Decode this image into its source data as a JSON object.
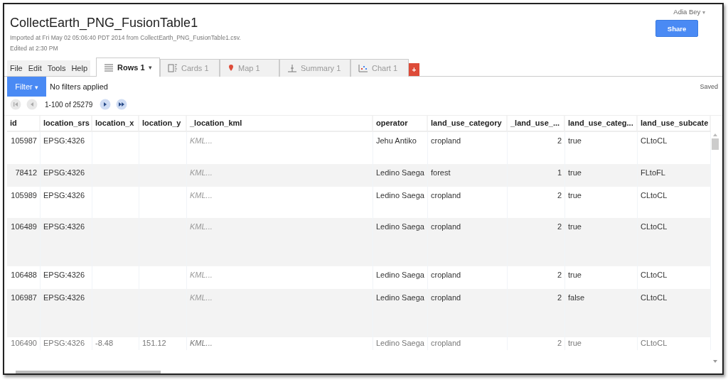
{
  "title": "CollectEarth_PNG_FusionTable1",
  "meta": [
    "Imported at Fri May 02 05:06:40 PDT 2014 from CollectEarth_PNG_FusionTable1.csv.",
    "Edited at 2:30 PM"
  ],
  "user": {
    "name": "Adia Bey",
    "caret": "▾"
  },
  "share": "Share",
  "menu": [
    "File",
    "Edit",
    "Tools",
    "Help"
  ],
  "tabs": [
    {
      "label": "Rows 1",
      "kind": "rows",
      "selected": true,
      "caret": "▾"
    },
    {
      "label": "Cards 1",
      "kind": "cards",
      "selected": false
    },
    {
      "label": "Map 1",
      "kind": "map",
      "selected": false
    },
    {
      "label": "Summary 1",
      "kind": "summary",
      "selected": false
    },
    {
      "label": "Chart 1",
      "kind": "chart",
      "selected": false
    }
  ],
  "add_tab": "+",
  "filter": {
    "label": "Filter",
    "caret": "▾",
    "status": "No filters applied"
  },
  "saved": "Saved",
  "pager": {
    "range": "1-100 of 25279",
    "buttons": [
      {
        "kind": "first",
        "disabled": true
      },
      {
        "kind": "prev",
        "disabled": true
      },
      {
        "kind": "next",
        "disabled": false
      },
      {
        "kind": "last",
        "disabled": false
      }
    ]
  },
  "table": {
    "columns": [
      "id",
      "location_srs",
      "location_x",
      "location_y",
      "_location_kml",
      "operator",
      "land_use_category",
      "_land_use_...",
      "land_use_categ...",
      "land_use_subcate"
    ],
    "rows": [
      {
        "cells": [
          "105987",
          "EPSG:4326",
          null,
          null,
          "KML...",
          "Jehu Antiko",
          "cropland",
          "2",
          "true",
          "CLtoCL"
        ],
        "dimmed": false
      },
      {
        "cells": [
          "78412",
          "EPSG:4326",
          null,
          null,
          "KML...",
          "Ledino Saega",
          "forest",
          "1",
          "true",
          "FLtoFL"
        ],
        "dimmed": false
      },
      {
        "cells": [
          "105989",
          "EPSG:4326",
          null,
          null,
          "KML...",
          "Ledino Saega",
          "cropland",
          "2",
          "true",
          "CLtoCL"
        ],
        "dimmed": false
      },
      {
        "cells": [
          "106489",
          "EPSG:4326",
          null,
          null,
          "KML...",
          "Ledino Saega",
          "cropland",
          "2",
          "true",
          "CLtoCL"
        ],
        "dimmed": false
      },
      {
        "cells": [
          "106488",
          "EPSG:4326",
          null,
          null,
          "KML...",
          "Ledino Saega",
          "cropland",
          "2",
          "true",
          "CLtoCL"
        ],
        "dimmed": false
      },
      {
        "cells": [
          "106987",
          "EPSG:4326",
          null,
          null,
          "KML...",
          "Ledino Saega",
          "cropland",
          "2",
          "false",
          "CLtoCL"
        ],
        "dimmed": false
      },
      {
        "cells": [
          "106490",
          "EPSG:4326",
          "-8.48",
          "151.12",
          "KML...",
          "Ledino Saega",
          "cropland",
          "2",
          "true",
          "CLtoCL"
        ],
        "dimmed": true
      }
    ]
  }
}
